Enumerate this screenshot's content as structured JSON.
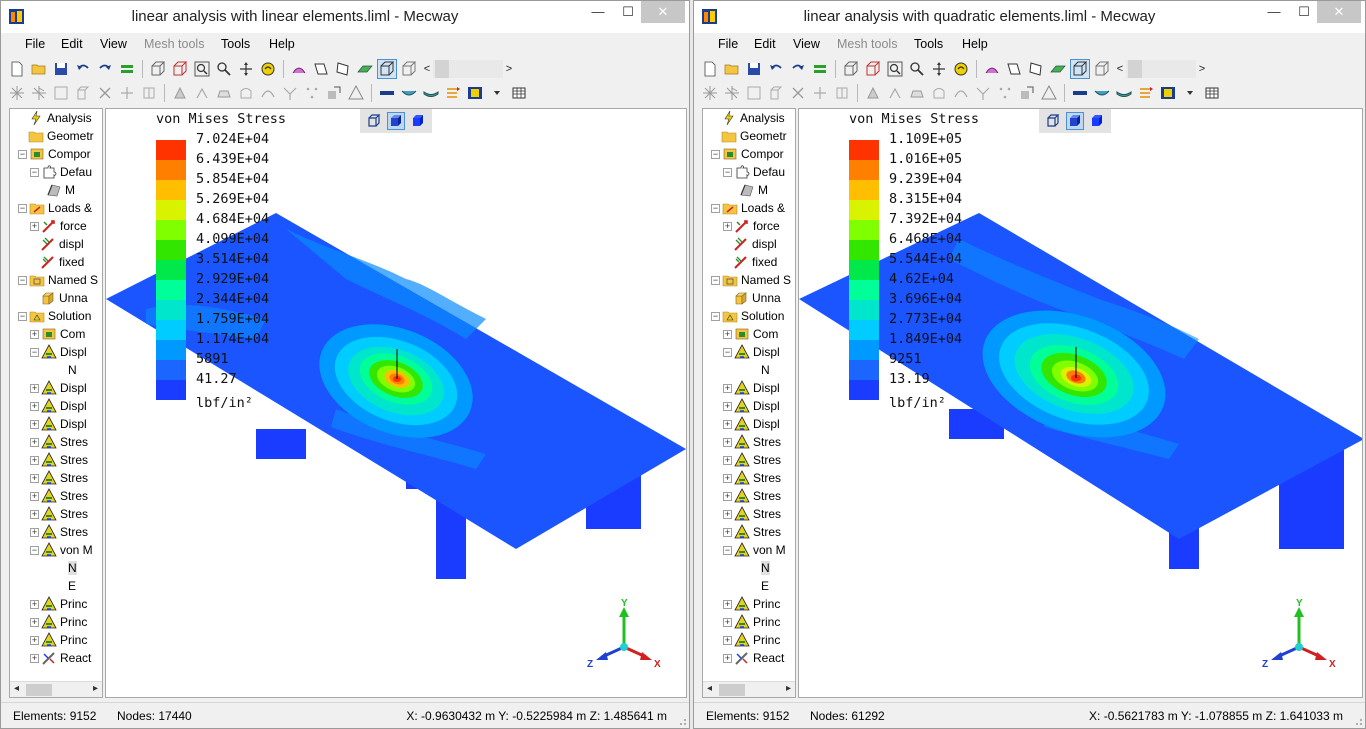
{
  "left_window": {
    "title": "linear analysis with linear elements.liml - Mecway",
    "menu": [
      {
        "label": "File"
      },
      {
        "label": "Edit"
      },
      {
        "label": "View"
      },
      {
        "label": "Mesh tools",
        "disabled": true
      },
      {
        "label": "Tools"
      },
      {
        "label": "Help"
      }
    ],
    "tree": [
      {
        "label": "Analysis",
        "icon": "lightning-icon"
      },
      {
        "label": "Geometr",
        "icon": "folder-icon"
      },
      {
        "label": "Compor",
        "icon": "component-icon",
        "expander": "−"
      },
      {
        "label": "Defau",
        "icon": "puzzle-icon",
        "expander": "−"
      },
      {
        "label": "M",
        "icon": "mesh-icon"
      },
      {
        "label": "Loads &",
        "icon": "loads-folder-icon",
        "expander": "−"
      },
      {
        "label": "force",
        "icon": "force-icon",
        "expander": "+"
      },
      {
        "label": "displ",
        "icon": "displacement-icon"
      },
      {
        "label": "fixed",
        "icon": "fixed-support-icon"
      },
      {
        "label": "Named S",
        "icon": "named-selection-icon",
        "expander": "−"
      },
      {
        "label": "Unna",
        "icon": "cube-icon"
      },
      {
        "label": "Solution",
        "icon": "solution-icon",
        "expander": "−"
      },
      {
        "label": "Com",
        "icon": "component-icon",
        "expander": "+"
      },
      {
        "label": "Displ",
        "icon": "result-icon",
        "expander": "−"
      },
      {
        "label": "N",
        "icon": ""
      },
      {
        "label": "Displ",
        "icon": "result-icon",
        "expander": "+"
      },
      {
        "label": "Displ",
        "icon": "result-icon",
        "expander": "+"
      },
      {
        "label": "Displ",
        "icon": "result-icon",
        "expander": "+"
      },
      {
        "label": "Stres",
        "icon": "result-icon",
        "expander": "+"
      },
      {
        "label": "Stres",
        "icon": "result-icon",
        "expander": "+"
      },
      {
        "label": "Stres",
        "icon": "result-icon",
        "expander": "+"
      },
      {
        "label": "Stres",
        "icon": "result-icon",
        "expander": "+"
      },
      {
        "label": "Stres",
        "icon": "result-icon",
        "expander": "+"
      },
      {
        "label": "Stres",
        "icon": "result-icon",
        "expander": "+"
      },
      {
        "label": "von M",
        "icon": "result-icon",
        "expander": "−"
      },
      {
        "label": "N",
        "icon": "",
        "selected": true
      },
      {
        "label": "E",
        "icon": ""
      },
      {
        "label": "Princ",
        "icon": "result-icon",
        "expander": "+"
      },
      {
        "label": "Princ",
        "icon": "result-icon",
        "expander": "+"
      },
      {
        "label": "Princ",
        "icon": "result-icon",
        "expander": "+"
      },
      {
        "label": "React",
        "icon": "reaction-icon",
        "expander": "+"
      }
    ],
    "legend": {
      "title": "von Mises Stress",
      "levels": [
        "7.024E+04",
        "6.439E+04",
        "5.854E+04",
        "5.269E+04",
        "4.684E+04",
        "4.099E+04",
        "3.514E+04",
        "2.929E+04",
        "2.344E+04",
        "1.759E+04",
        "1.174E+04",
        "5891",
        "41.27"
      ],
      "unit": "lbf/in²"
    },
    "status": {
      "elements": "Elements:  9152",
      "nodes": "Nodes: 17440",
      "coords": "X: -0.9630432 m Y: -0.5225984 m Z: 1.485641 m"
    }
  },
  "right_window": {
    "title": "linear analysis with quadratic elements.liml - Mecway",
    "menu": [
      {
        "label": "File"
      },
      {
        "label": "Edit"
      },
      {
        "label": "View"
      },
      {
        "label": "Mesh tools",
        "disabled": true
      },
      {
        "label": "Tools"
      },
      {
        "label": "Help"
      }
    ],
    "tree": [
      {
        "label": "Analysis",
        "icon": "lightning-icon"
      },
      {
        "label": "Geometr",
        "icon": "folder-icon"
      },
      {
        "label": "Compor",
        "icon": "component-icon",
        "expander": "−"
      },
      {
        "label": "Defau",
        "icon": "puzzle-icon",
        "expander": "−"
      },
      {
        "label": "M",
        "icon": "mesh-icon"
      },
      {
        "label": "Loads &",
        "icon": "loads-folder-icon",
        "expander": "−"
      },
      {
        "label": "force",
        "icon": "force-icon",
        "expander": "+"
      },
      {
        "label": "displ",
        "icon": "displacement-icon"
      },
      {
        "label": "fixed",
        "icon": "fixed-support-icon"
      },
      {
        "label": "Named S",
        "icon": "named-selection-icon",
        "expander": "−"
      },
      {
        "label": "Unna",
        "icon": "cube-icon"
      },
      {
        "label": "Solution",
        "icon": "solution-icon",
        "expander": "−"
      },
      {
        "label": "Com",
        "icon": "component-icon",
        "expander": "+"
      },
      {
        "label": "Displ",
        "icon": "result-icon",
        "expander": "−"
      },
      {
        "label": "N",
        "icon": ""
      },
      {
        "label": "Displ",
        "icon": "result-icon",
        "expander": "+"
      },
      {
        "label": "Displ",
        "icon": "result-icon",
        "expander": "+"
      },
      {
        "label": "Displ",
        "icon": "result-icon",
        "expander": "+"
      },
      {
        "label": "Stres",
        "icon": "result-icon",
        "expander": "+"
      },
      {
        "label": "Stres",
        "icon": "result-icon",
        "expander": "+"
      },
      {
        "label": "Stres",
        "icon": "result-icon",
        "expander": "+"
      },
      {
        "label": "Stres",
        "icon": "result-icon",
        "expander": "+"
      },
      {
        "label": "Stres",
        "icon": "result-icon",
        "expander": "+"
      },
      {
        "label": "Stres",
        "icon": "result-icon",
        "expander": "+"
      },
      {
        "label": "von M",
        "icon": "result-icon",
        "expander": "−"
      },
      {
        "label": "N",
        "icon": "",
        "selected": true
      },
      {
        "label": "E",
        "icon": ""
      },
      {
        "label": "Princ",
        "icon": "result-icon",
        "expander": "+"
      },
      {
        "label": "Princ",
        "icon": "result-icon",
        "expander": "+"
      },
      {
        "label": "Princ",
        "icon": "result-icon",
        "expander": "+"
      },
      {
        "label": "React",
        "icon": "reaction-icon",
        "expander": "+"
      }
    ],
    "legend": {
      "title": "von Mises Stress",
      "levels": [
        "1.109E+05",
        "1.016E+05",
        "9.239E+04",
        "8.315E+04",
        "7.392E+04",
        "6.468E+04",
        "5.544E+04",
        "4.62E+04",
        "3.696E+04",
        "2.773E+04",
        "1.849E+04",
        "9251",
        "13.19"
      ],
      "unit": "lbf/in²"
    },
    "status": {
      "elements": "Elements:  9152",
      "nodes": "Nodes: 61292",
      "coords": "X: -0.5621783 m Y: -1.078855 m Z: 1.641033 m"
    }
  },
  "legend_colors": [
    "#ff3300",
    "#ff8000",
    "#ffbf00",
    "#d9f200",
    "#80ff00",
    "#33e600",
    "#00e84a",
    "#00ff99",
    "#00e6cc",
    "#00ccff",
    "#0099ff",
    "#1a66ff",
    "#1a3cff"
  ],
  "axis_labels": {
    "x": "X",
    "y": "Y",
    "z": "Z"
  }
}
